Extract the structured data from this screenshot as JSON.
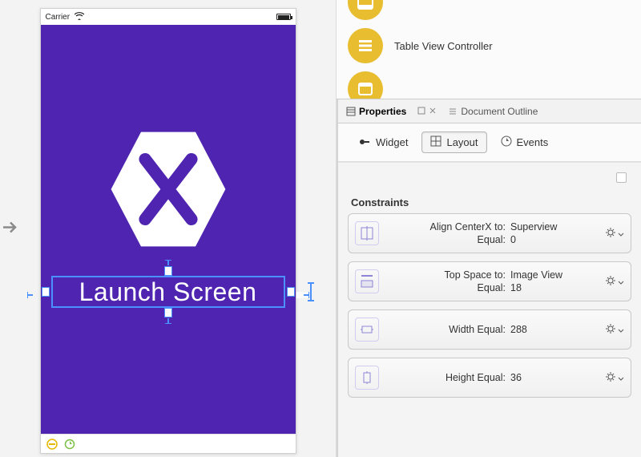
{
  "canvas": {
    "carrier_label": "Carrier",
    "launch_label": "Launch Screen"
  },
  "toolbox": {
    "item_top": "",
    "item_table": "Table View Controller",
    "item_view": ""
  },
  "panel": {
    "tab_properties": "Properties",
    "tab_outline": "Document Outline",
    "subtab_widget": "Widget",
    "subtab_layout": "Layout",
    "subtab_events": "Events",
    "truncated_option": ""
  },
  "constraints": {
    "section_label": "Constraints",
    "items": [
      {
        "label1": "Align CenterX to:",
        "value1": "Superview",
        "label2": "Equal:",
        "value2": "0"
      },
      {
        "label1": "Top Space to:",
        "value1": "Image View",
        "label2": "Equal:",
        "value2": "18"
      },
      {
        "label1": "Width Equal:",
        "value1": "288",
        "label2": "",
        "value2": ""
      },
      {
        "label1": "Height Equal:",
        "value1": "36",
        "label2": "",
        "value2": ""
      }
    ]
  }
}
